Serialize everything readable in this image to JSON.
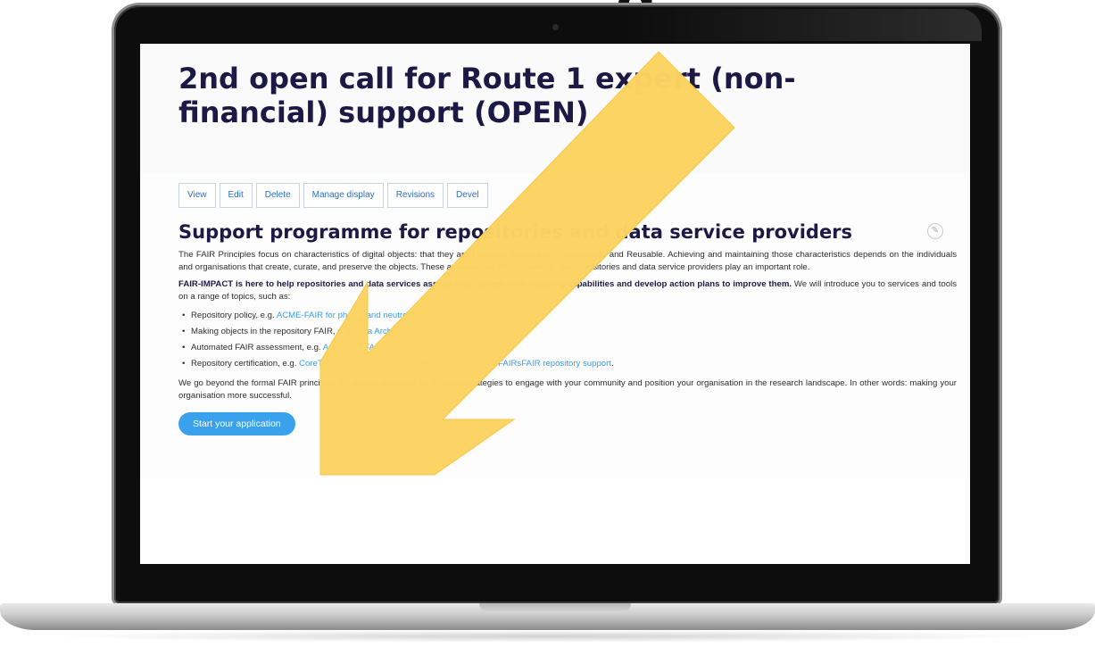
{
  "page": {
    "title": "2nd open call for Route 1 expert (non-financial) support (OPEN)",
    "tabs": [
      "View",
      "Edit",
      "Delete",
      "Manage display",
      "Revisions",
      "Devel"
    ]
  },
  "section": {
    "heading": "Support programme for repositories and data service providers",
    "intro": "The FAIR Principles focus on characteristics of digital objects: that they are Findable, Accessible, Interoperable and Reusable. Achieving and maintaining those characteristics depends on the individuals and organisations that create, curate, and preserve the objects. These activities are 'FAIR-enabling', and repositories and data service providers play an important role.",
    "fair_impact_bold": "FAIR-IMPACT is here to help repositories and data services assess your current FAIR-enabling capabilities and develop action plans to improve them.",
    "fair_impact_rest": " We will introduce you to services and tools on a range of topics, such as:",
    "list": [
      {
        "text": "Repository policy, e.g. ",
        "link": "ACME-FAIR for photon and neutron science",
        "suffix": ";"
      },
      {
        "text": "Making objects in the repository FAIR, e.g. ",
        "link": "Data Archiving Guide, FAIR Cookbook",
        "suffix": ";"
      },
      {
        "text": "Automated FAIR assessment, e.g. ",
        "link": "Assessing FAIR services",
        "suffix": ";"
      },
      {
        "text": "Repository certification, e.g. ",
        "link": "CoreTrustSeal, Certifying Capability Maturity Model, FAIRsFAIR repository support",
        "suffix": "."
      }
    ],
    "outro": "We go beyond the formal FAIR principles by offering guidance for effective strategies to engage with your community and position your organisation in the research landscape. In other words: making your organisation more successful.",
    "start_label": "Start your application"
  },
  "overlay": {
    "top_text": "g",
    "arrow_color": "#fcd462"
  }
}
